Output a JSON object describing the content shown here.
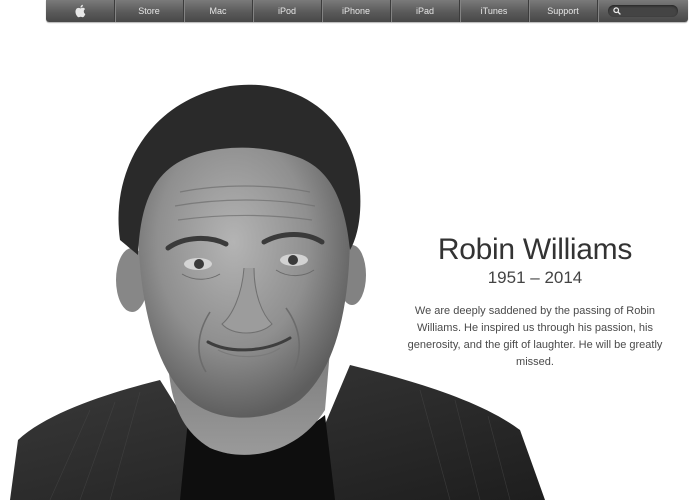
{
  "nav": {
    "items": [
      "Store",
      "Mac",
      "iPod",
      "iPhone",
      "iPad",
      "iTunes",
      "Support"
    ]
  },
  "tribute": {
    "name": "Robin Williams",
    "years": "1951 – 2014",
    "message": "We are deeply saddened by the passing of Robin Williams. He inspired us through his passion, his generosity, and the gift of laughter. He will be greatly missed."
  }
}
